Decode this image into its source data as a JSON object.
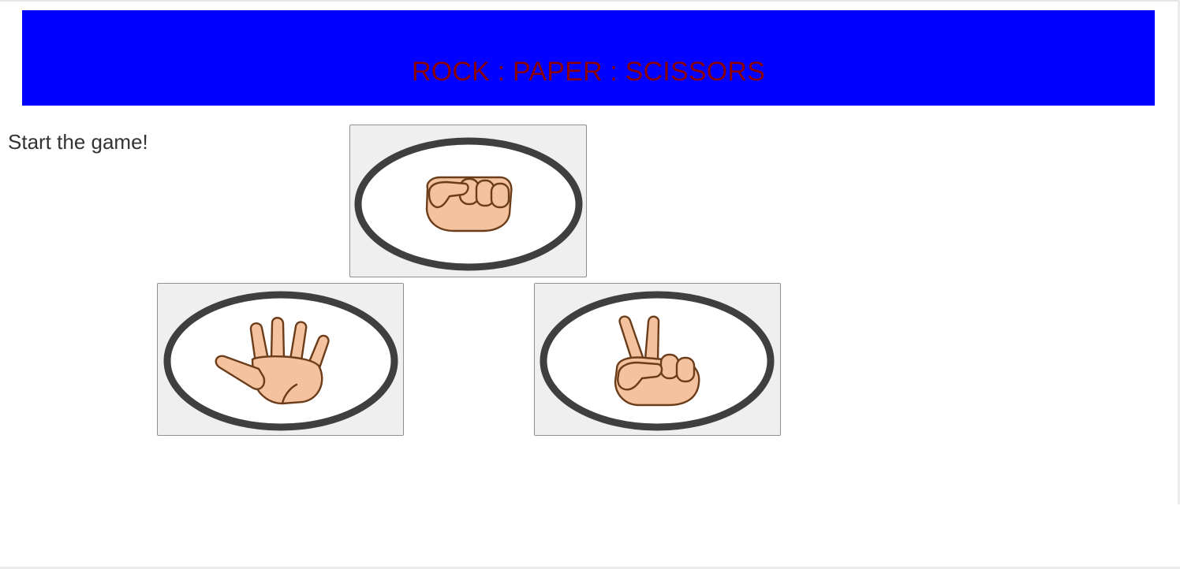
{
  "header": {
    "title": "ROCK : PAPER : SCISSORS",
    "background_color": "#0000ff",
    "title_color": "#8b0000"
  },
  "status": {
    "text": "Start the game!"
  },
  "choices": [
    {
      "id": "rock",
      "icon": "fist-hand-icon"
    },
    {
      "id": "paper",
      "icon": "open-hand-icon"
    },
    {
      "id": "scissors",
      "icon": "peace-hand-icon"
    }
  ],
  "colors": {
    "skin": "#f4c29e",
    "outline": "#6b3d1a",
    "ring": "#3f3f3f",
    "button_bg": "#efefef"
  }
}
